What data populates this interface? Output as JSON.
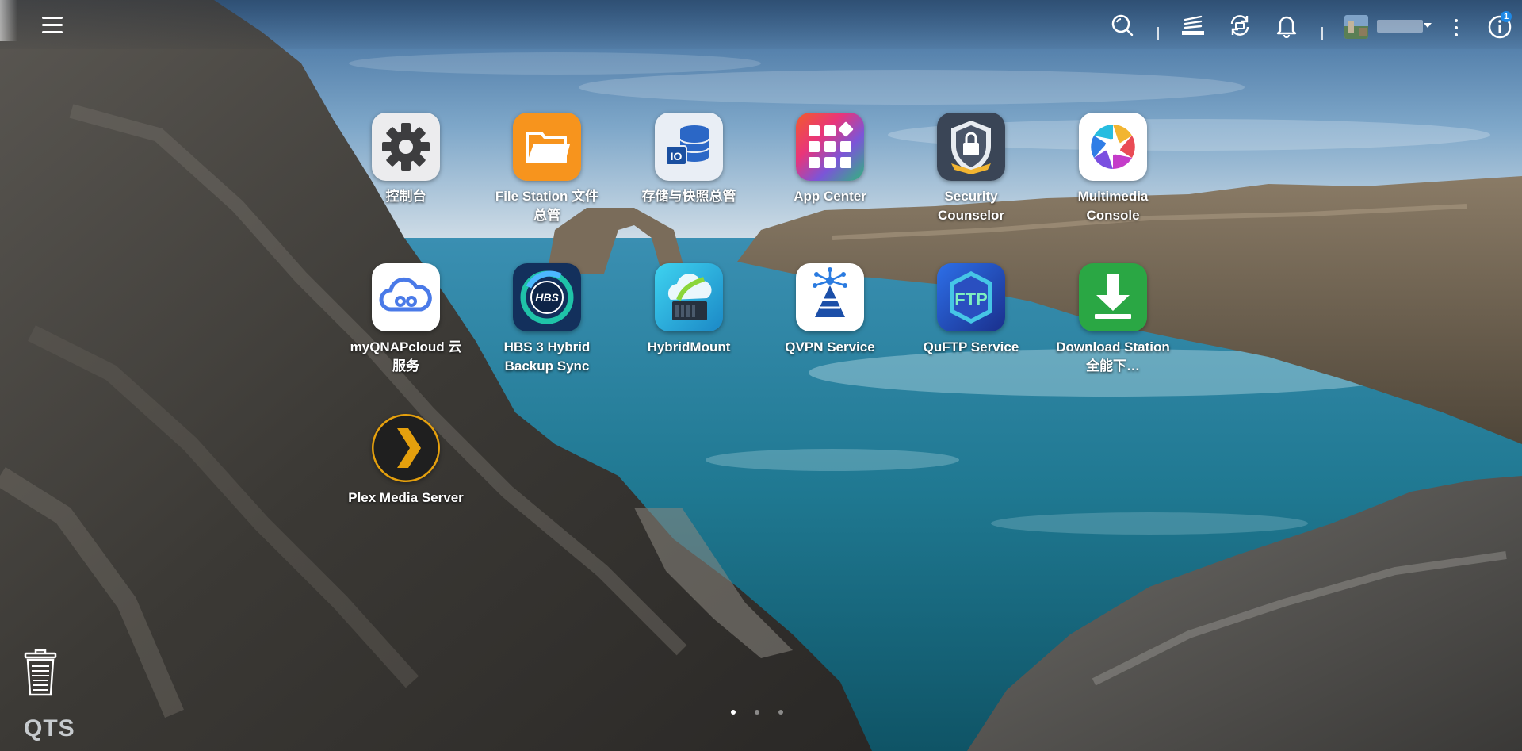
{
  "topbar": {
    "menu_icon": "hamburger-icon",
    "icons": [
      "search-icon",
      "background-tasks-icon",
      "sync-icon",
      "bell-icon"
    ],
    "user": {
      "avatar": "user-avatar-image",
      "name": "",
      "caret": "chevron-down-icon"
    },
    "more_icon": "kebab-menu-icon",
    "info": {
      "icon": "info-icon",
      "badge": "1"
    }
  },
  "apps": [
    {
      "name": "控制台",
      "icon": "gear-icon",
      "color": "#e8e8ea"
    },
    {
      "name": "File Station 文件总管",
      "icon": "folder-icon",
      "color": "#f7941d"
    },
    {
      "name": "存储与快照总管",
      "icon": "storage-database-icon",
      "color": "#e9eef5"
    },
    {
      "name": "App Center",
      "icon": "app-grid-icon",
      "color": "#e94b8a"
    },
    {
      "name": "Security Counselor",
      "icon": "shield-lock-icon",
      "color": "#3a4556"
    },
    {
      "name": "Multimedia Console",
      "icon": "aperture-icon",
      "color": "#ffffff"
    },
    {
      "name": "myQNAPcloud 云服务",
      "icon": "cloud-icon",
      "color": "#ffffff"
    },
    {
      "name": "HBS 3 Hybrid Backup Sync",
      "icon": "hbs-icon",
      "color": "#13305c"
    },
    {
      "name": "HybridMount",
      "icon": "cloud-drive-icon",
      "color": "#2ec8e0"
    },
    {
      "name": "QVPN Service",
      "icon": "vpn-tower-icon",
      "color": "#ffffff"
    },
    {
      "name": "QuFTP Service",
      "icon": "ftp-icon",
      "color": "#1e46b0"
    },
    {
      "name": "Download Station 全能下…",
      "icon": "download-icon",
      "color": "#2aa744"
    },
    {
      "name": "Plex Media Server",
      "icon": "plex-chevron-icon",
      "color": "#1f1f1f"
    }
  ],
  "bottom": {
    "trash_icon": "recycle-bin-icon",
    "logo": "QTS",
    "pages": 3,
    "active_page": 1
  }
}
